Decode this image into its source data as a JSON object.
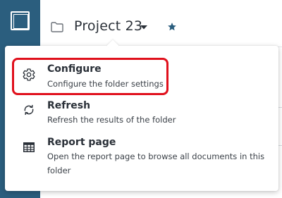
{
  "header": {
    "project_title": "Project 23"
  },
  "menu": {
    "items": [
      {
        "title": "Configure",
        "description": "Configure the folder settings",
        "icon": "gear-icon"
      },
      {
        "title": "Refresh",
        "description": "Refresh the results of the folder",
        "icon": "refresh-icon"
      },
      {
        "title": "Report page",
        "description": "Open the report page to browse all documents in this folder",
        "icon": "table-icon"
      }
    ]
  },
  "colors": {
    "sidebar": "#2b5e7e",
    "star": "#2b5e7e",
    "highlight": "#e0101c"
  }
}
